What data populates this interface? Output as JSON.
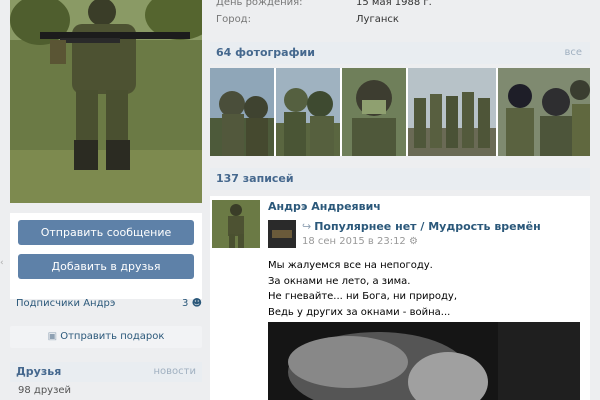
{
  "profile": {
    "birthday_label": "День рождения:",
    "birthday_value": "15 мая 1988 г.",
    "city_label": "Город:",
    "city_value": "Луганск"
  },
  "actions": {
    "send_message": "Отправить сообщение",
    "add_friend": "Добавить в друзья",
    "subscribers_label": "Подписчики Андрэ",
    "subscribers_count": "3",
    "send_gift": "Отправить подарок"
  },
  "friends": {
    "title": "Друзья",
    "more": "новости",
    "count_text": "98 друзей"
  },
  "photos": {
    "title": "64 фотографии",
    "all": "все"
  },
  "wall": {
    "title": "137 записей"
  },
  "post": {
    "author": "Андрэ Андреявич",
    "repost_source": "Популярнее нет / Мудрость времён",
    "date": "18 сен 2015 в 23:12",
    "lines": [
      "Мы жалуемся все на непогоду.",
      "За окнами не лето, а зима.",
      "Не гневайте... ни Бога, ни природу,",
      "Ведь у других за окнами - война..."
    ]
  },
  "colors": {
    "accent": "#5e81a8",
    "link": "#2b587a",
    "header_bg": "#e9edf1",
    "page_bg": "#edeef0"
  }
}
